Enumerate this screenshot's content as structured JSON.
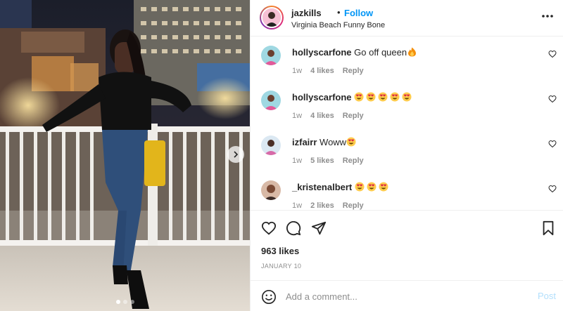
{
  "header": {
    "username": "jazkills",
    "separator": "•",
    "follow_label": "Follow",
    "location": "Virginia Beach Funny Bone",
    "more_icon": "more-horizontal-icon"
  },
  "comments": [
    {
      "username": "hollyscarfone",
      "text": "Go off queen",
      "emoji": [
        "fire"
      ],
      "emoji_count": 1,
      "time": "1w",
      "likes": "4 likes",
      "reply": "Reply"
    },
    {
      "username": "hollyscarfone",
      "text": "",
      "emoji": [
        "heart-eyes"
      ],
      "emoji_count": 5,
      "time": "1w",
      "likes": "4 likes",
      "reply": "Reply"
    },
    {
      "username": "izfairr",
      "text": "Woww",
      "emoji": [
        "heart-eyes"
      ],
      "emoji_count": 1,
      "time": "1w",
      "likes": "5 likes",
      "reply": "Reply"
    },
    {
      "username": "_kristenalbert",
      "text": "",
      "emoji": [
        "heart-eyes"
      ],
      "emoji_count": 3,
      "time": "1w",
      "likes": "2 likes",
      "reply": "Reply"
    }
  ],
  "actions": {
    "like_icon": "heart-icon",
    "comment_icon": "comment-icon",
    "share_icon": "send-icon",
    "save_icon": "bookmark-icon",
    "likes": "963 likes",
    "date": "JANUARY 10"
  },
  "add_comment": {
    "placeholder": "Add a comment...",
    "post_label": "Post",
    "emoji_icon": "smiley-icon"
  },
  "carousel": {
    "slides": 3,
    "active_index": 0
  },
  "colors": {
    "link_blue": "#0095f6",
    "post_disabled": "#b2dffc",
    "meta_gray": "#8e8e8e",
    "text": "#262626"
  }
}
